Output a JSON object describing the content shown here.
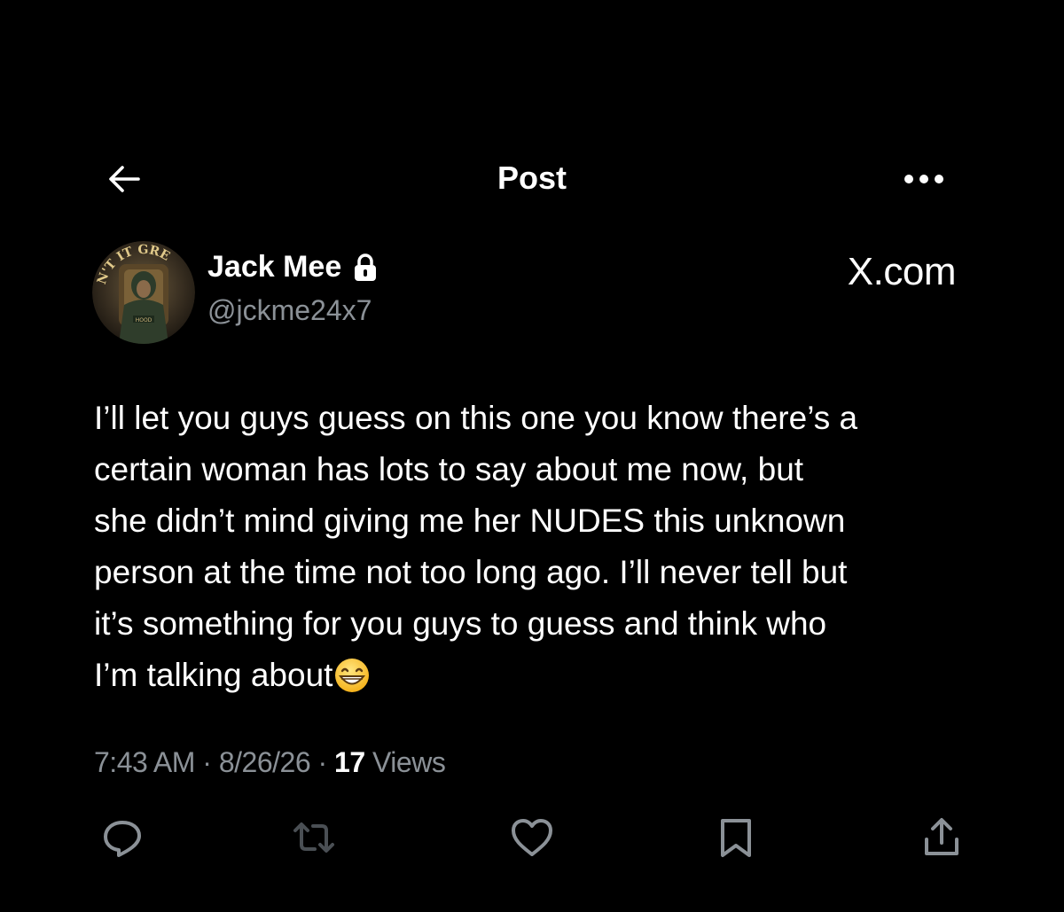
{
  "header": {
    "title": "Post",
    "back_icon": "arrow-left-icon",
    "more_icon": "more-horizontal-icon"
  },
  "author": {
    "name": "Jack Mee",
    "handle": "@jckme24x7",
    "protected_icon": "lock-icon",
    "avatar_badge_text": "N'T IT GRE"
  },
  "watermark": {
    "text": "X.com"
  },
  "post": {
    "lines": [
      "I’ll let you guys guess on this one you know there’s a",
      "certain woman has lots to say about me now, but",
      "she didn’t mind giving me her NUDES this unknown",
      "person at the time not too long ago. I’ll never tell but",
      "it’s something for you guys to guess and think who",
      "I’m talking about"
    ],
    "emoji": "grinning-face-icon"
  },
  "meta": {
    "time": "7:43 AM",
    "separator": "·",
    "date": "8/26/26",
    "views_count": "17",
    "views_label": "Views"
  },
  "actions": [
    {
      "name": "reply-icon"
    },
    {
      "name": "repost-icon"
    },
    {
      "name": "like-icon"
    },
    {
      "name": "bookmark-icon"
    },
    {
      "name": "share-icon"
    }
  ],
  "colors": {
    "background": "#000000",
    "primary_text": "#ffffff",
    "secondary_text": "#8b9197",
    "icon": "#8b9197",
    "repost_icon_dim": "#4a4f54"
  }
}
